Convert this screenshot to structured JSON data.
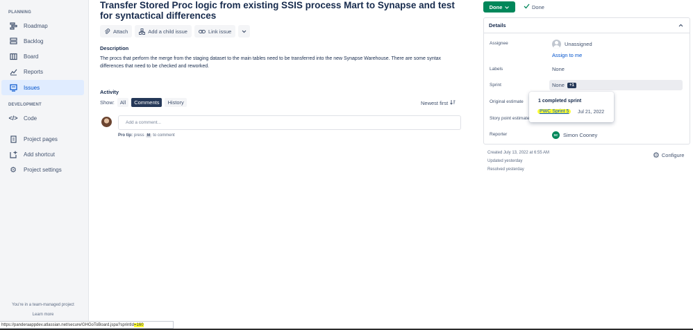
{
  "sidebar": {
    "planning_title": "PLANNING",
    "planning_items": [
      {
        "label": "Roadmap",
        "icon": "roadmap-icon"
      },
      {
        "label": "Backlog",
        "icon": "backlog-icon"
      },
      {
        "label": "Board",
        "icon": "board-icon"
      },
      {
        "label": "Reports",
        "icon": "reports-icon"
      },
      {
        "label": "Issues",
        "icon": "issues-icon",
        "active": true
      }
    ],
    "development_title": "DEVELOPMENT",
    "code_label": "Code",
    "project_pages_label": "Project pages",
    "add_shortcut_label": "Add shortcut",
    "project_settings_label": "Project settings",
    "footer_text": "You're in a team-managed project",
    "learn_more": "Learn more"
  },
  "issue": {
    "title": "Transfer Stored Proc logic from existing SSIS process Mart to Synapse and test for syntactical differences",
    "toolbar": {
      "attach": "Attach",
      "add_child": "Add a child issue",
      "link_issue": "Link issue"
    },
    "description_label": "Description",
    "description_text": "The procs that perform the merge from the staging dataset to the main tables need to be transferred into the new Synapse Warehouse. There are some syntax differences that need to be checked and reworked."
  },
  "activity": {
    "label": "Activity",
    "show_label": "Show:",
    "filters": [
      "All",
      "Comments",
      "History"
    ],
    "selected_filter": "Comments",
    "sort_label": "Newest first",
    "comment_placeholder": "Add a comment...",
    "protip_prefix": "Pro tip:",
    "protip_press": "press",
    "protip_key": "M",
    "protip_suffix": "to comment"
  },
  "status": {
    "button_label": "Done",
    "resolution": "Done",
    "color": "#00875a"
  },
  "details": {
    "heading": "Details",
    "assignee_label": "Assignee",
    "assignee_value": "Unassigned",
    "assign_to_me": "Assign to me",
    "labels_label": "Labels",
    "labels_value": "None",
    "sprint_label": "Sprint",
    "sprint_value": "None",
    "sprint_badge": "+1",
    "original_estimate_label": "Original estimate",
    "story_points_label": "Story point estimate",
    "reporter_label": "Reporter",
    "reporter_initials": "SC",
    "reporter_name": "Simon Cooney"
  },
  "sprint_popup": {
    "title": "1 completed sprint",
    "sprint_name": "PWC Sprint 5",
    "sprint_date": "Jul 21, 2022"
  },
  "meta": {
    "created": "Created July 13, 2022 at 6:55 AM",
    "updated": "Updated yesterday",
    "resolved": "Resolved yesterday",
    "configure": "Configure"
  },
  "statusbar": {
    "url": "https://panderaappdev.atlassian.net/secure/GHGoToBoard.jspa?sprintId",
    "url_highlight": "=160"
  }
}
